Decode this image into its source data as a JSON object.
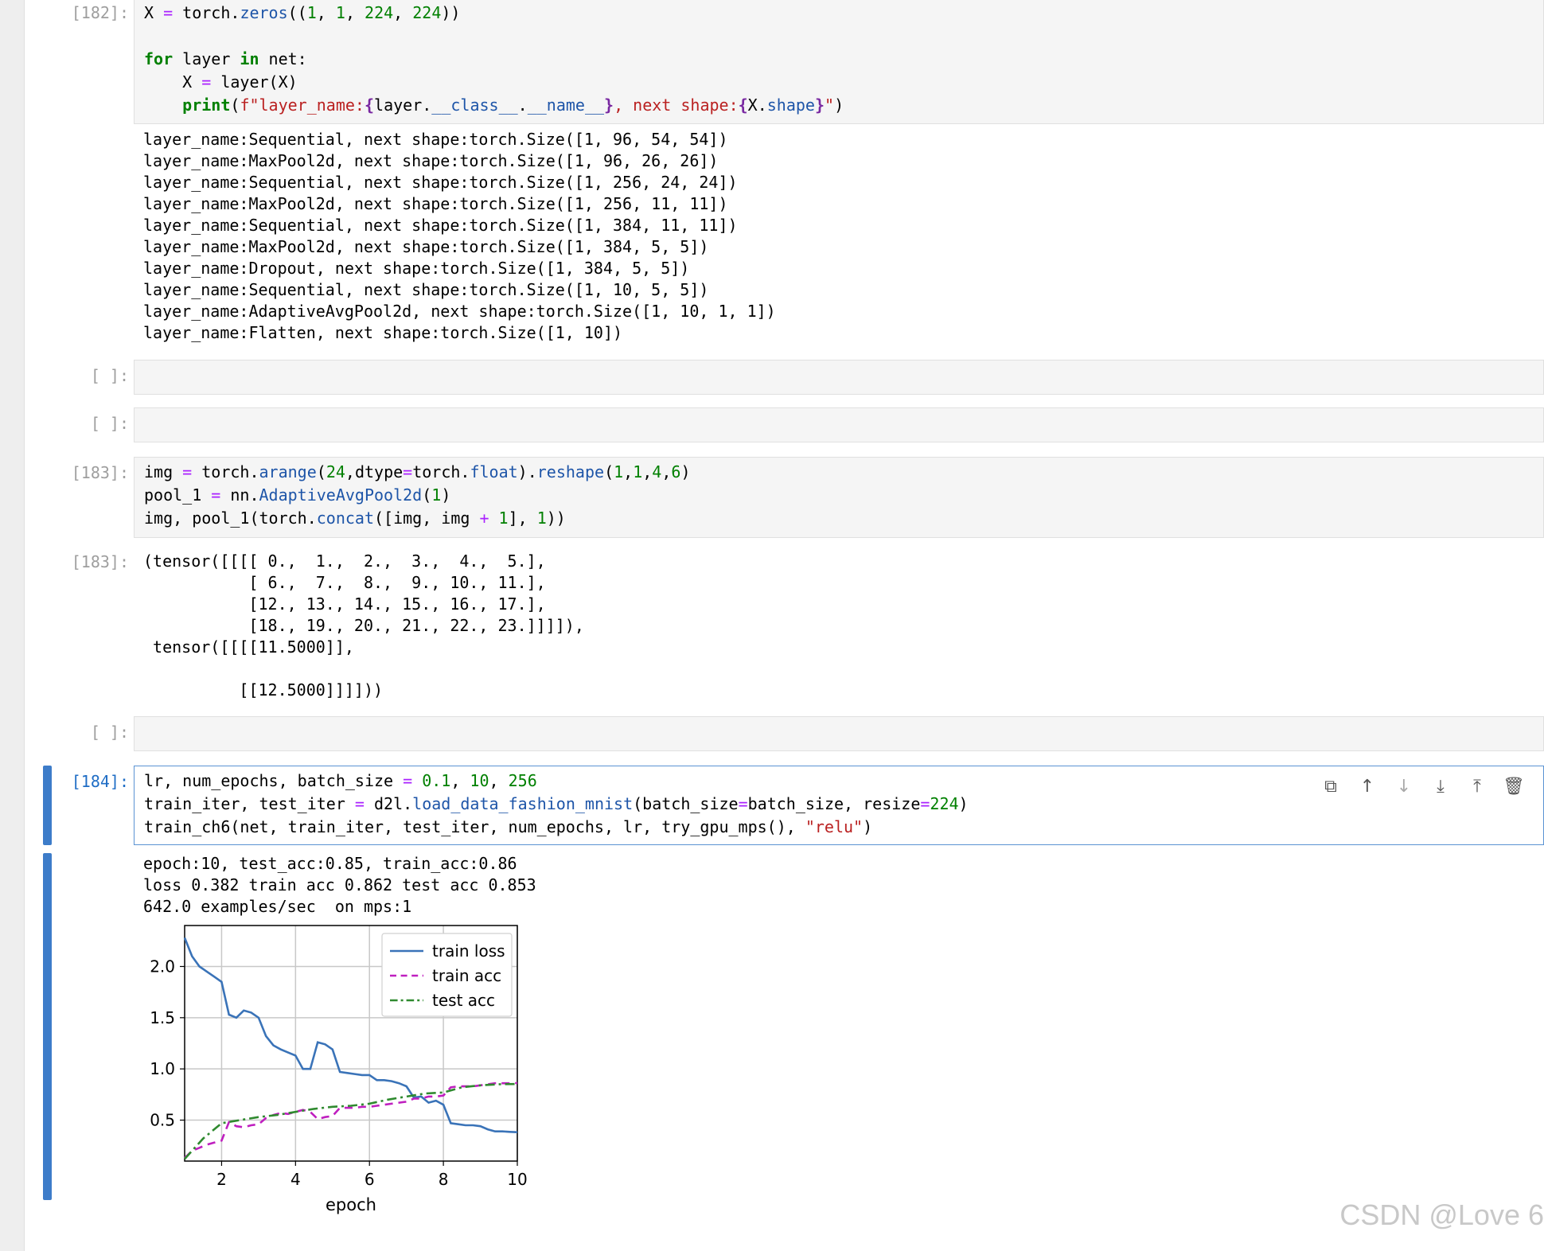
{
  "cells": [
    {
      "prompt": "[182]:",
      "code": [
        "X = torch.zeros((1, 1, 224, 224))",
        "",
        "for layer in net:",
        "    X = layer(X)",
        "    print(f\"layer_name:{layer.__class__.__name__}, next shape:{X.shape}\")"
      ],
      "output": "layer_name:Sequential, next shape:torch.Size([1, 96, 54, 54])\nlayer_name:MaxPool2d, next shape:torch.Size([1, 96, 26, 26])\nlayer_name:Sequential, next shape:torch.Size([1, 256, 24, 24])\nlayer_name:MaxPool2d, next shape:torch.Size([1, 256, 11, 11])\nlayer_name:Sequential, next shape:torch.Size([1, 384, 11, 11])\nlayer_name:MaxPool2d, next shape:torch.Size([1, 384, 5, 5])\nlayer_name:Dropout, next shape:torch.Size([1, 384, 5, 5])\nlayer_name:Sequential, next shape:torch.Size([1, 10, 5, 5])\nlayer_name:AdaptiveAvgPool2d, next shape:torch.Size([1, 10, 1, 1])\nlayer_name:Flatten, next shape:torch.Size([1, 10])"
    },
    {
      "prompt": "[ ]:"
    },
    {
      "prompt": "[ ]:"
    },
    {
      "prompt": "[183]:",
      "code": [
        "img = torch.arange(24,dtype=torch.float).reshape(1,1,4,6)",
        "pool_1 = nn.AdaptiveAvgPool2d(1)",
        "img, pool_1(torch.concat([img, img + 1], 1))"
      ],
      "output_prompt": "[183]:",
      "output": "(tensor([[[[ 0.,  1.,  2.,  3.,  4.,  5.],\n           [ 6.,  7.,  8.,  9., 10., 11.],\n           [12., 13., 14., 15., 16., 17.],\n           [18., 19., 20., 21., 22., 23.]]]]),\n tensor([[[[11.5000]],\n\n          [[12.5000]]]]))"
    },
    {
      "prompt": "[ ]:"
    },
    {
      "prompt": "[184]:",
      "code": [
        "lr, num_epochs, batch_size = 0.1, 10, 256",
        "train_iter, test_iter = d2l.load_data_fashion_mnist(batch_size=batch_size, resize=224)",
        "train_ch6(net, train_iter, test_iter, num_epochs, lr, try_gpu_mps(), \"relu\")"
      ],
      "output": "epoch:10, test_acc:0.85, train_acc:0.86\nloss 0.382 train acc 0.862 test acc 0.853\n642.0 examples/sec  on mps:1"
    }
  ],
  "toolbar": {
    "icons": [
      "copy-icon",
      "move-up-icon",
      "move-down-icon",
      "insert-below-icon",
      "insert-above-icon",
      "delete-icon"
    ]
  },
  "chart_data": {
    "type": "line",
    "xlabel": "epoch",
    "ylabel": "",
    "xlim": [
      1,
      10
    ],
    "ylim": [
      0.1,
      2.4
    ],
    "xticks": [
      2,
      4,
      6,
      8,
      10
    ],
    "yticks": [
      0.5,
      1.0,
      1.5,
      2.0
    ],
    "ytick_labels": [
      "0.5",
      "1.0",
      "1.5",
      "2.0"
    ],
    "grid": true,
    "legend_position": "top-right",
    "series": [
      {
        "name": "train loss",
        "color": "#3a73b8",
        "dash": "",
        "x": [
          1.0,
          1.2,
          1.4,
          1.6,
          1.8,
          2.0,
          2.2,
          2.4,
          2.6,
          2.8,
          3.0,
          3.2,
          3.4,
          3.6,
          3.8,
          4.0,
          4.2,
          4.4,
          4.6,
          4.8,
          5.0,
          5.2,
          5.4,
          5.6,
          5.8,
          6.0,
          6.2,
          6.4,
          6.6,
          6.8,
          7.0,
          7.2,
          7.4,
          7.6,
          7.8,
          8.0,
          8.2,
          8.4,
          8.6,
          8.8,
          9.0,
          9.2,
          9.4,
          9.6,
          9.8,
          10.0
        ],
        "y": [
          2.28,
          2.1,
          2.0,
          1.95,
          1.9,
          1.85,
          1.53,
          1.5,
          1.57,
          1.55,
          1.5,
          1.32,
          1.23,
          1.19,
          1.16,
          1.13,
          1.0,
          1.0,
          1.26,
          1.24,
          1.19,
          0.97,
          0.96,
          0.95,
          0.94,
          0.94,
          0.89,
          0.89,
          0.88,
          0.86,
          0.83,
          0.72,
          0.73,
          0.67,
          0.69,
          0.65,
          0.47,
          0.46,
          0.45,
          0.45,
          0.44,
          0.41,
          0.39,
          0.39,
          0.385,
          0.382
        ]
      },
      {
        "name": "train acc",
        "color": "#bf1fbf",
        "dash": "10,7",
        "x": [
          1.0,
          1.2,
          1.4,
          1.6,
          1.8,
          2.0,
          2.2,
          2.4,
          2.6,
          2.8,
          3.0,
          3.2,
          3.4,
          3.6,
          3.8,
          4.0,
          4.2,
          4.4,
          4.6,
          4.8,
          5.0,
          5.2,
          5.4,
          5.6,
          5.8,
          6.0,
          6.2,
          6.4,
          6.6,
          6.8,
          7.0,
          7.2,
          7.4,
          7.6,
          7.8,
          8.0,
          8.2,
          8.4,
          8.6,
          8.8,
          9.0,
          9.2,
          9.4,
          9.6,
          9.8,
          10.0
        ],
        "y": [
          0.13,
          0.2,
          0.23,
          0.26,
          0.28,
          0.3,
          0.48,
          0.44,
          0.43,
          0.45,
          0.46,
          0.52,
          0.55,
          0.57,
          0.56,
          0.58,
          0.6,
          0.58,
          0.51,
          0.53,
          0.54,
          0.62,
          0.62,
          0.62,
          0.63,
          0.63,
          0.64,
          0.65,
          0.66,
          0.67,
          0.68,
          0.71,
          0.71,
          0.73,
          0.73,
          0.74,
          0.82,
          0.83,
          0.83,
          0.83,
          0.84,
          0.85,
          0.86,
          0.86,
          0.86,
          0.862
        ]
      },
      {
        "name": "test acc",
        "color": "#2f8a2f",
        "dash": "12,5,3,5",
        "x": [
          1.0,
          1.5,
          2.0,
          2.5,
          3.0,
          3.5,
          4.0,
          4.5,
          5.0,
          5.5,
          6.0,
          6.5,
          7.0,
          7.5,
          8.0,
          8.5,
          9.0,
          9.5,
          10.0
        ],
        "y": [
          0.12,
          0.32,
          0.47,
          0.5,
          0.53,
          0.55,
          0.58,
          0.61,
          0.63,
          0.64,
          0.66,
          0.7,
          0.73,
          0.76,
          0.77,
          0.82,
          0.84,
          0.85,
          0.853
        ]
      }
    ]
  },
  "watermark": "CSDN @Love 6"
}
